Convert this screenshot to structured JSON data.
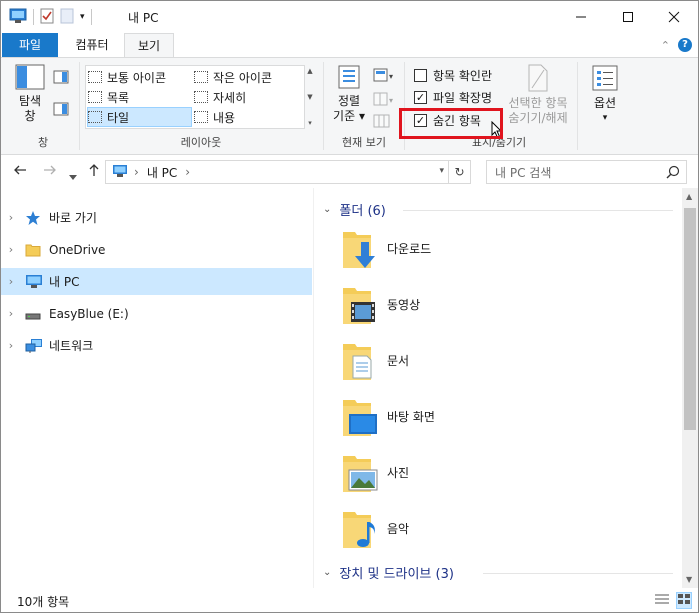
{
  "window": {
    "title": "내 PC"
  },
  "tabs": {
    "file": "파일",
    "computer": "컴퓨터",
    "view": "보기"
  },
  "ribbon": {
    "pane_group": {
      "nav_pane_label_line1": "탐색",
      "nav_pane_label_line2": "창",
      "group_label": "창"
    },
    "layout_group": {
      "items": [
        "보통 아이콘",
        "작은 아이콘",
        "목록",
        "자세히",
        "타일",
        "내용"
      ],
      "selected": "타일",
      "group_label": "레이아웃"
    },
    "current_view_group": {
      "sort_label_line1": "정렬",
      "sort_label_line2": "기준",
      "group_label": "현재 보기"
    },
    "show_hide_group": {
      "item_checkboxes": {
        "label": "항목 확인란",
        "checked": false
      },
      "file_extensions": {
        "label": "파일 확장명",
        "checked": true
      },
      "hidden_items": {
        "label": "숨긴 항목",
        "checked": true
      },
      "hide_selected_line1": "선택한 항목",
      "hide_selected_line2": "숨기기/해제",
      "group_label": "표시/숨기기"
    },
    "options_label": "옵션"
  },
  "address": {
    "path_root": "내 PC",
    "search_placeholder": "내 PC 검색"
  },
  "nav_pane": {
    "items": [
      {
        "label": "바로 가기",
        "icon": "star-icon"
      },
      {
        "label": "OneDrive",
        "icon": "onedrive-folder-icon"
      },
      {
        "label": "내 PC",
        "icon": "computer-icon",
        "selected": true
      },
      {
        "label": "EasyBlue (E:)",
        "icon": "drive-icon"
      },
      {
        "label": "네트워크",
        "icon": "network-icon"
      }
    ]
  },
  "content": {
    "folders_header": "폴더 (6)",
    "folders": [
      "다운로드",
      "동영상",
      "문서",
      "바탕 화면",
      "사진",
      "음악"
    ],
    "devices_header": "장치 및 드라이브 (3)"
  },
  "status": {
    "item_count": "10개 항목"
  },
  "colors": {
    "accent": "#1979ca",
    "highlight_box": "#e0141e",
    "selection": "#cce8ff",
    "folder": "#f4cc58"
  }
}
